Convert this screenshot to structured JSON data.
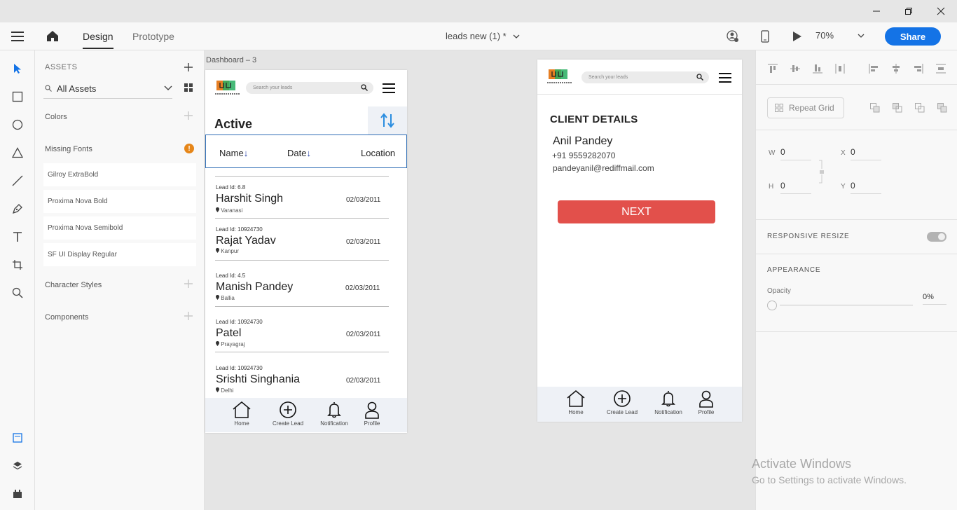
{
  "toolbar": {
    "tabs": [
      "Design",
      "Prototype"
    ],
    "doc_title": "leads new (1) *",
    "zoom": "70%",
    "share_label": "Share"
  },
  "assets": {
    "header": "ASSETS",
    "filter": "All Assets",
    "colors_label": "Colors",
    "missing_fonts_label": "Missing Fonts",
    "missing_fonts_badge": "!",
    "fonts": [
      "Gilroy ExtraBold",
      "Proxima Nova Bold",
      "Proxima Nova Semibold",
      "SF UI Display Regular"
    ],
    "character_styles_label": "Character Styles",
    "components_label": "Components"
  },
  "artboards": {
    "dashboard": {
      "label": "Dashboard – 3",
      "search_placeholder": "Search your leads",
      "active_title": "Active",
      "columns": {
        "name": "Name",
        "date": "Date",
        "location": "Location",
        "sort_arrow": "↓"
      },
      "leads": [
        {
          "lead_id": "Lead Id: 6.8",
          "name": "Harshit Singh",
          "date": "02/03/2011",
          "location": "Varanasi"
        },
        {
          "lead_id": "Lead Id: 10924730",
          "name": "Rajat Yadav",
          "date": "02/03/2011",
          "location": "Kanpur"
        },
        {
          "lead_id": "Lead Id: 4.5",
          "name": "Manish Pandey",
          "date": "02/03/2011",
          "location": "Ballia"
        },
        {
          "lead_id": "Lead Id: 10924730",
          "name": "Patel",
          "date": "02/03/2011",
          "location": "Prayagraj"
        },
        {
          "lead_id": "Lead Id: 10924730",
          "name": "Srishti Singhania",
          "date": "02/03/2011",
          "location": "Delhi"
        }
      ],
      "nav": [
        "Home",
        "Create Lead",
        "Notification",
        "Profile"
      ]
    },
    "client": {
      "search_placeholder": "Search your leads",
      "title": "CLIENT DETAILS",
      "name": "Anil Pandey",
      "phone": "+91 9559282070",
      "email": "pandeyanil@rediffmail.com",
      "next_label": "NEXT",
      "nav": [
        "Home",
        "Create Lead",
        "Notification",
        "Profile"
      ]
    }
  },
  "properties": {
    "repeat_grid_label": "Repeat Grid",
    "w_label": "W",
    "w_value": "0",
    "h_label": "H",
    "h_value": "0",
    "x_label": "X",
    "x_value": "0",
    "y_label": "Y",
    "y_value": "0",
    "responsive_resize_label": "RESPONSIVE RESIZE",
    "appearance_label": "APPEARANCE",
    "opacity_label": "Opacity",
    "opacity_value": "0%"
  },
  "watermark": {
    "line1": "Activate Windows",
    "line2": "Go to Settings to activate Windows."
  },
  "colors": {
    "accent": "#1473e6",
    "next_button": "#e2504b",
    "warning": "#e68619",
    "header_border": "#2f6db5"
  }
}
